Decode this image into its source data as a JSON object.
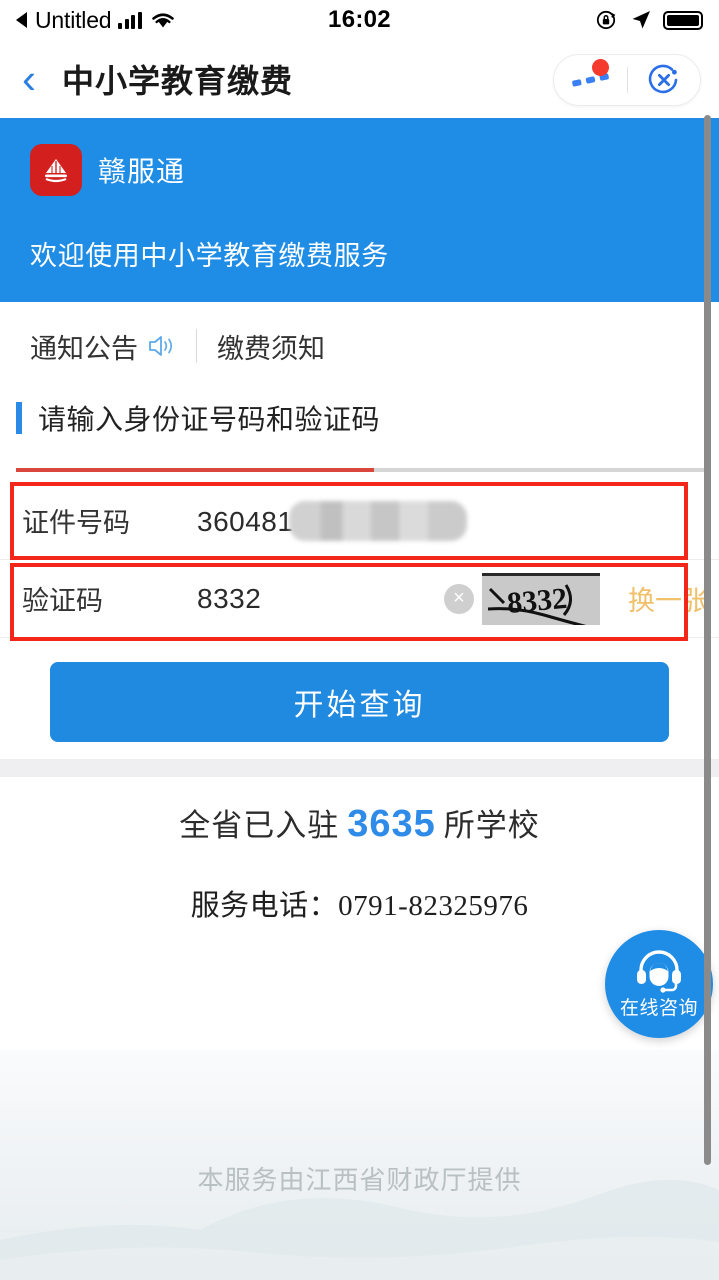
{
  "status_bar": {
    "back_label": "Untitled",
    "time": "16:02",
    "icons": [
      "signal-bars-icon",
      "wifi-icon",
      "rotation-lock-icon",
      "location-arrow-icon",
      "battery-icon"
    ]
  },
  "nav": {
    "back_icon": "chevron-left-icon",
    "title": "中小学教育缴费",
    "capsule": {
      "more_icon": "more-dots-icon",
      "close_icon": "close-target-icon",
      "badge": ""
    }
  },
  "banner": {
    "brand_name": "赣服通",
    "brand_logo_icon": "ganfutong-pavilion-logo",
    "welcome": "欢迎使用中小学教育缴费服务",
    "bg_color": "#1f8ce6"
  },
  "tabs": [
    {
      "label": "通知公告",
      "icon": "speaker-announce-icon",
      "active": true
    },
    {
      "label": "缴费须知",
      "icon": "",
      "active": false
    }
  ],
  "section": {
    "title": "请输入身份证号码和验证码",
    "accent_color": "#2b8ae6",
    "rule_color": "#d9463c"
  },
  "form": {
    "id_row": {
      "label": "证件号码",
      "value": "360481",
      "redacted": true
    },
    "captcha_row": {
      "label": "验证码",
      "value": "8332",
      "clear_icon": "clear-circle-icon",
      "captcha_image_text": "8332",
      "refresh_label": "换一张",
      "refresh_color": "#f0c06a"
    },
    "submit_label": "开始查询",
    "submit_color": "#2089e0"
  },
  "stats": {
    "prefix": "全省已入驻",
    "count": "3635",
    "suffix": "所学校",
    "count_color": "#2e8ce8",
    "phone_line": "服务电话：0791-82325976"
  },
  "consult": {
    "label": "在线咨询",
    "icon": "headset-agent-icon",
    "color": "#1f8ce6"
  },
  "footer": {
    "text": "本服务由江西省财政厅提供"
  },
  "annotations": {
    "id_box_color": "#f3261a",
    "captcha_box_color": "#f3261a"
  }
}
